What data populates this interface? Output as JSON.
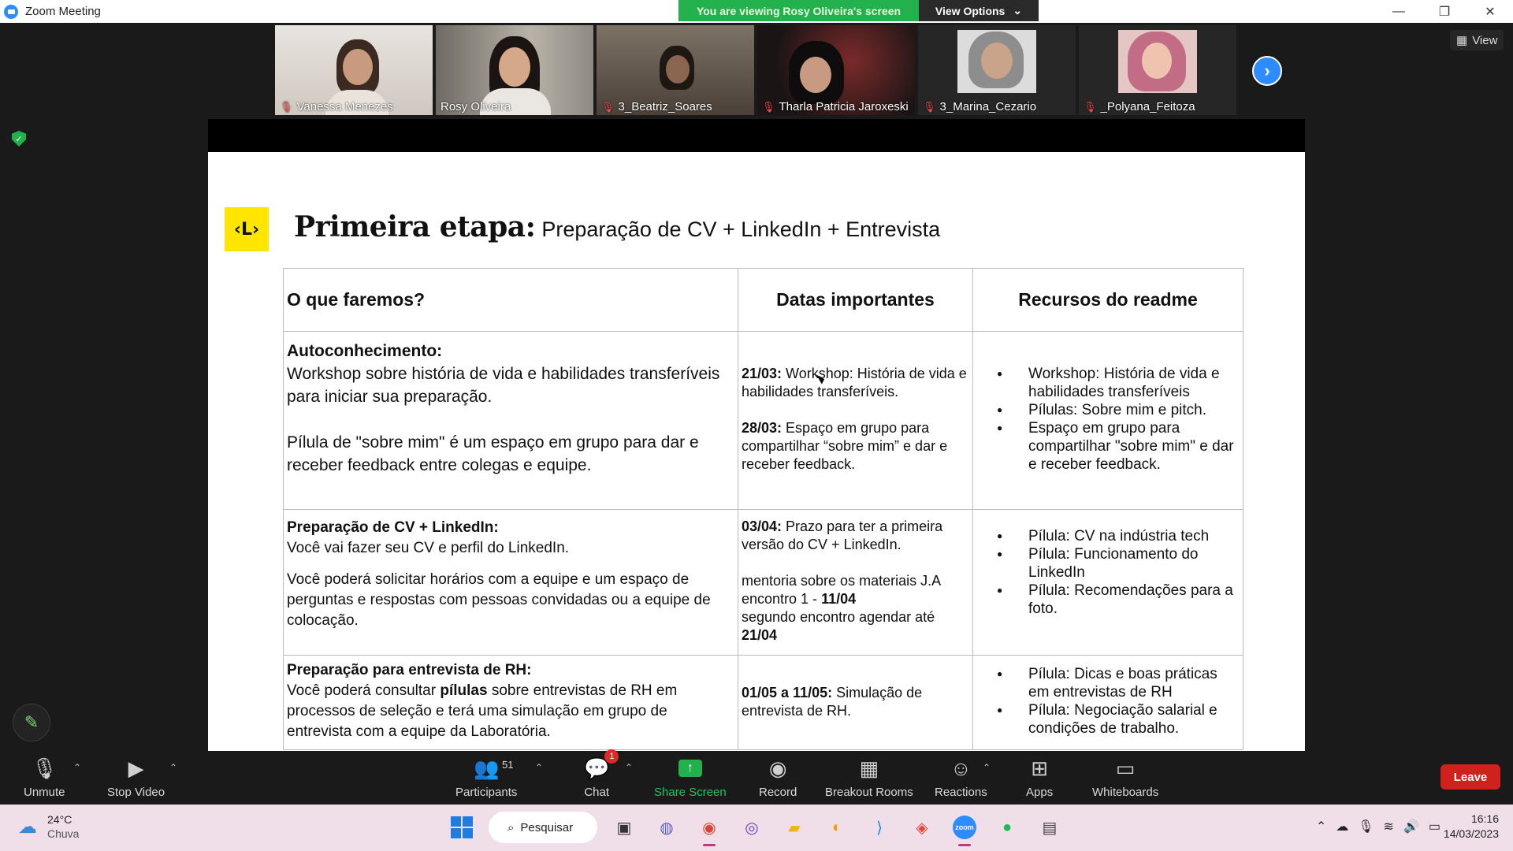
{
  "window": {
    "title": "Zoom Meeting",
    "controls": [
      "—",
      "❐",
      "✕"
    ]
  },
  "banner": {
    "viewing_text": "You are viewing Rosy Oliveira's screen",
    "view_options_label": "View Options"
  },
  "participants_strip": [
    {
      "name": "Vanessa Menezes",
      "muted": true,
      "active": false
    },
    {
      "name": "Rosy Oliveira",
      "muted": false,
      "active": true
    },
    {
      "name": "3_Beatriz_Soares",
      "muted": true,
      "active": false
    },
    {
      "name": "Tharla Patricia Jaroxeski",
      "muted": true,
      "active": false
    },
    {
      "name": "3_Marina_Cezario",
      "muted": true,
      "active": false
    },
    {
      "name": "_Polyana_Feitoza",
      "muted": true,
      "active": false
    }
  ],
  "view_button_label": "View",
  "slide": {
    "logo": "‹L›",
    "title_bold": "Primeira etapa:",
    "title_rest": "Preparação de CV + LinkedIn + Entrevista",
    "headers": [
      "O que faremos?",
      "Datas importantes",
      "Recursos do readme"
    ],
    "rows": [
      {
        "col1_head": "Autoconhecimento:",
        "col1_p1": "Workshop sobre história de vida e habilidades transferíveis para iniciar sua preparação.",
        "col1_p2": "Pílula de \"sobre mim\" é um espaço em grupo para dar e receber feedback entre colegas e equipe.",
        "dates": [
          {
            "date": "21/03:",
            "text": " Workshop: História de vida e habilidades transferíveis."
          },
          {
            "date": "28/03:",
            "text": " Espaço em grupo para compartilhar “sobre mim” e dar e receber feedback."
          }
        ],
        "resources": [
          "Workshop: História de vida e habilidades transferíveis",
          "Pílulas: Sobre mim e pitch.",
          "Espaço em grupo para compartilhar \"sobre mim\" e dar e receber feedback."
        ]
      },
      {
        "col1_head": "Preparação de CV + LinkedIn:",
        "col1_p1": "Você vai fazer seu CV e perfil do LinkedIn.",
        "col1_p2": "Você poderá solicitar horários com a equipe e um espaço de perguntas e respostas com pessoas convidadas ou a equipe de colocação.",
        "date1_bold": "03/04:",
        "date1_text": " Prazo para ter a primeira versão do CV + LinkedIn.",
        "date2_line1": "mentoria sobre os materiais J.A",
        "date2_line2_pre": "encontro 1 - ",
        "date2_line2_bold": "11/04",
        "date2_line3": "segundo encontro agendar até",
        "date2_line4_bold": "21/04",
        "resources": [
          "Pílula: CV na indústria tech",
          "Pílula: Funcionamento do LinkedIn",
          "Pílula: Recomendações para a foto."
        ]
      },
      {
        "col1_head": "Preparação para entrevista de RH:",
        "col1_pre": "Você poderá consultar ",
        "col1_bold": "pílulas",
        "col1_post": " sobre entrevistas de RH em processos de seleção e terá uma simulação em grupo de entrevista com a equipe da Laboratória.",
        "date_bold": "01/05 a 11/05:",
        "date_text": " Simulação de entrevista de RH.",
        "resources": [
          "Pílula: Dicas e boas práticas em entrevistas de RH",
          "Pílula: Negociação salarial e condições de trabalho."
        ]
      }
    ]
  },
  "toolbar": {
    "unmute": "Unmute",
    "stop_video": "Stop Video",
    "participants": "Participants",
    "participants_count": "51",
    "chat": "Chat",
    "chat_badge": "1",
    "share_screen": "Share Screen",
    "record": "Record",
    "breakout_rooms": "Breakout Rooms",
    "reactions": "Reactions",
    "apps": "Apps",
    "whiteboards": "Whiteboards",
    "leave": "Leave"
  },
  "taskbar": {
    "temperature": "24°C",
    "condition": "Chuva",
    "search_placeholder": "Pesquisar",
    "time": "16:16",
    "date": "14/03/2023"
  }
}
